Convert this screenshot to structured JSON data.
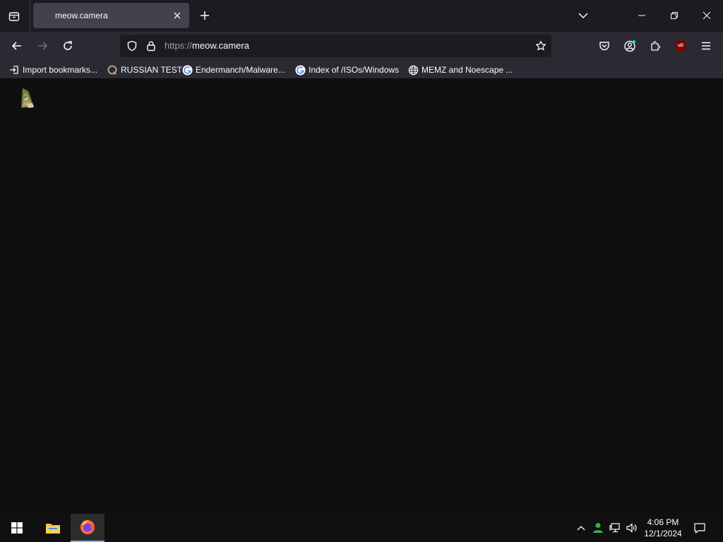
{
  "browser": {
    "tab": {
      "title": "meow.camera"
    },
    "url": {
      "scheme": "https://",
      "host": "meow.camera"
    },
    "bookmarks": [
      {
        "label": "Import bookmarks...",
        "icon": "import-icon"
      },
      {
        "label": "RUSSIAN TEST",
        "icon": "site-favicon"
      },
      {
        "label": "Endermanch/Malware...",
        "icon": "google-favicon"
      },
      {
        "label": "Index of /ISOs/Windows",
        "icon": "google-favicon"
      },
      {
        "label": "MEMZ and Noescape ...",
        "icon": "globe-icon"
      }
    ],
    "extension_badge": "uD"
  },
  "taskbar": {
    "time": "4:06 PM",
    "date": "12/1/2024"
  },
  "colors": {
    "accent": "#76b9ed",
    "tab_active": "#42414d",
    "toolbar": "#2b2a33",
    "content_bg": "#0f0f10"
  }
}
